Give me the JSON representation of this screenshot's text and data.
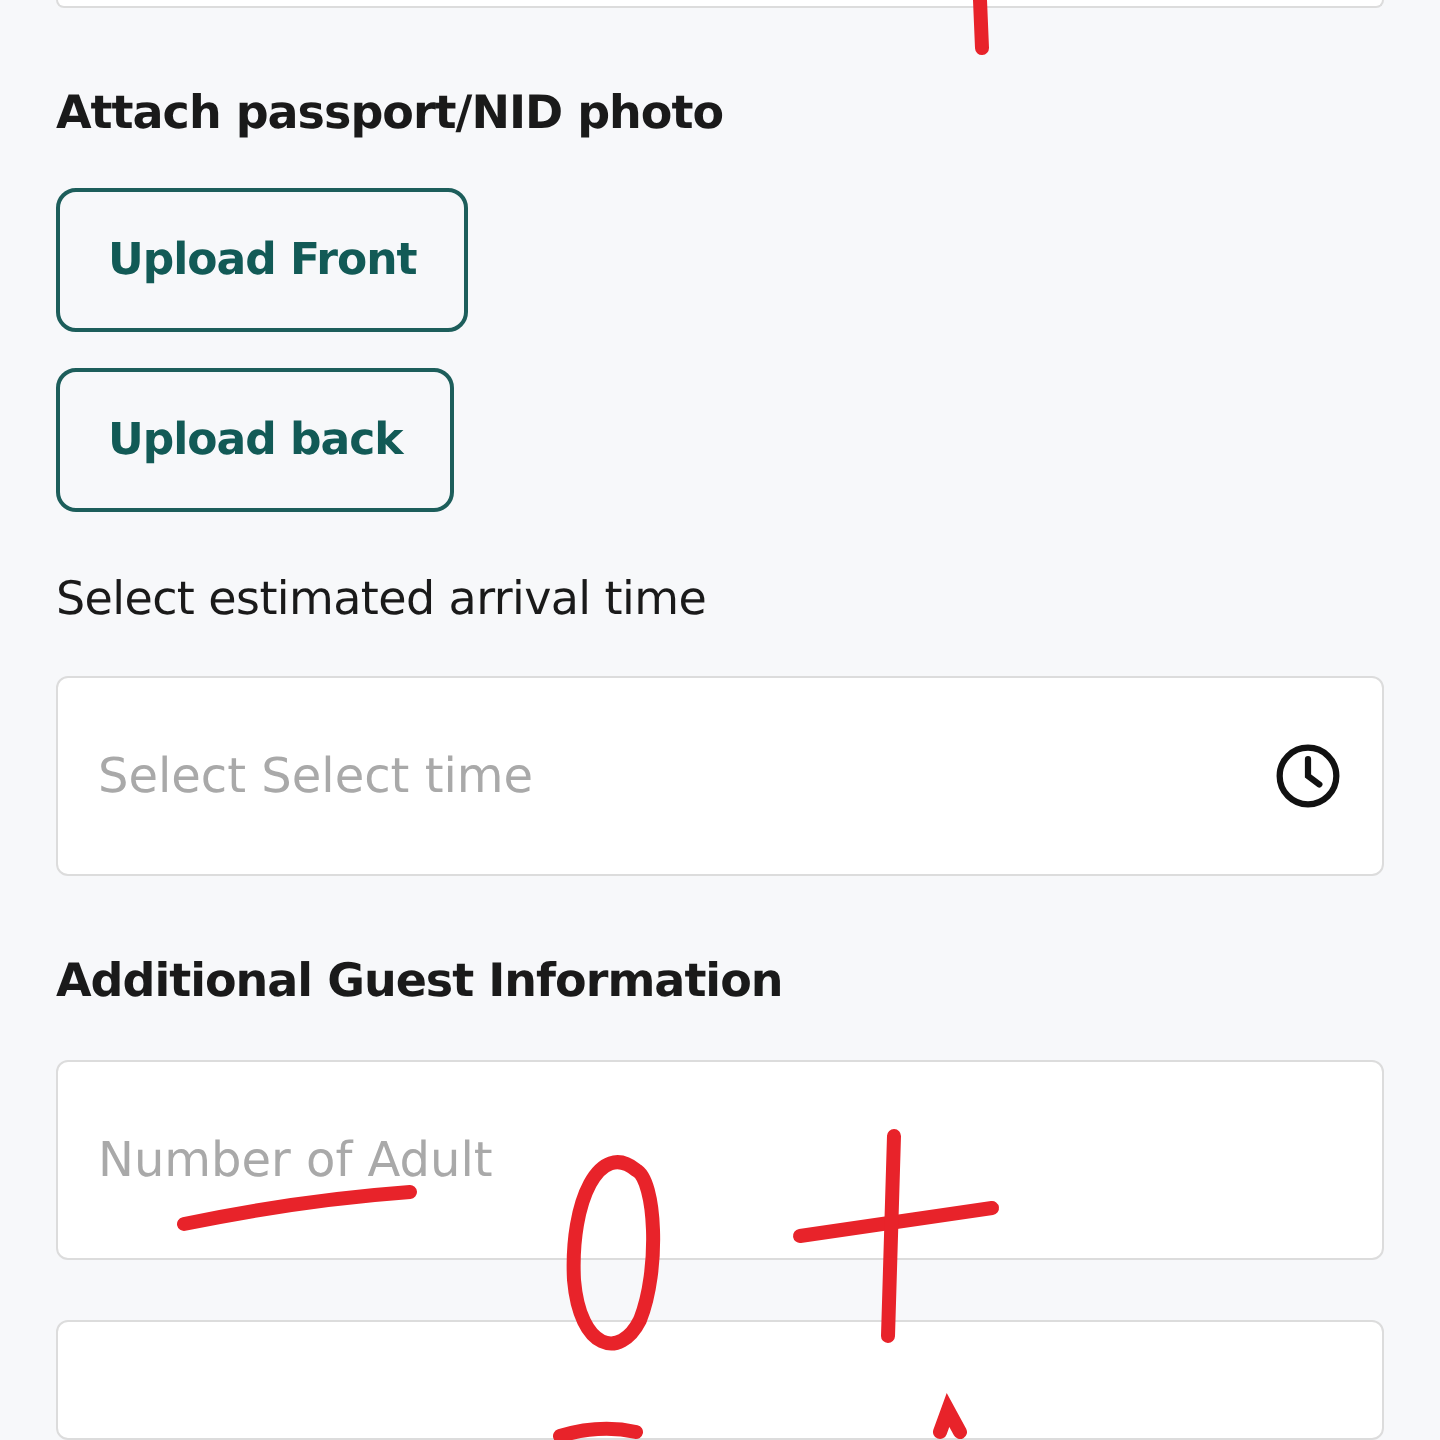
{
  "passport_section": {
    "label": "Attach passport/NID photo",
    "buttons": [
      "Upload Front",
      "Upload back"
    ]
  },
  "arrival_time": {
    "label": "Select estimated arrival time",
    "placeholder": "Select Select time"
  },
  "guest_info": {
    "heading": "Additional Guest Information",
    "fields": [
      {
        "placeholder": "Number of Adult"
      }
    ]
  }
}
